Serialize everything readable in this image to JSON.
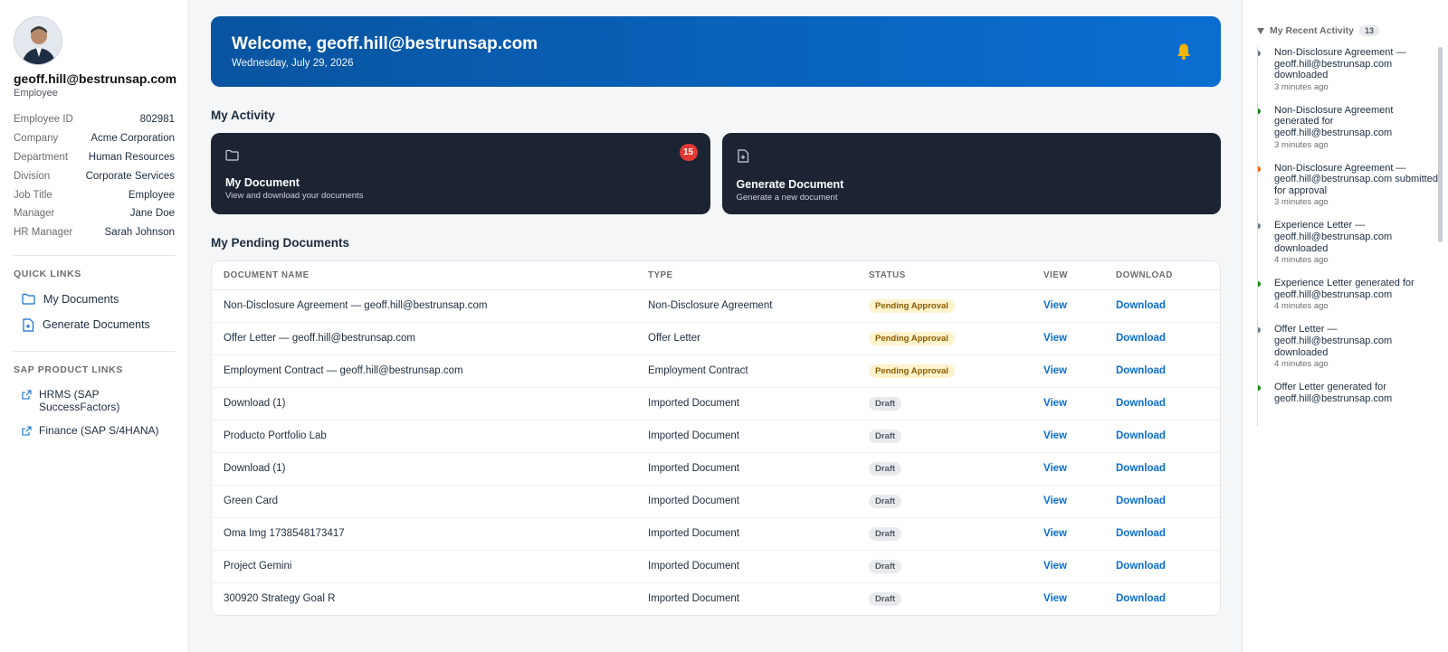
{
  "user": {
    "email": "geoff.hill@bestrunsap.com",
    "role": "Employee",
    "info": [
      {
        "label": "Employee ID",
        "value": "802981"
      },
      {
        "label": "Company",
        "value": "Acme Corporation"
      },
      {
        "label": "Department",
        "value": "Human Resources"
      },
      {
        "label": "Division",
        "value": "Corporate Services"
      },
      {
        "label": "Job Title",
        "value": "Employee"
      },
      {
        "label": "Manager",
        "value": "Jane Doe"
      },
      {
        "label": "HR Manager",
        "value": "Sarah Johnson"
      }
    ]
  },
  "quick_links": {
    "title": "QUICK LINKS",
    "items": [
      {
        "label": "My Documents",
        "icon": "folder-icon"
      },
      {
        "label": "Generate Documents",
        "icon": "file-plus-icon"
      }
    ]
  },
  "product_links": {
    "title": "SAP PRODUCT LINKS",
    "items": [
      {
        "label": "HRMS (SAP SuccessFactors)",
        "icon": "external-link-icon"
      },
      {
        "label": "Finance (SAP S/4HANA)",
        "icon": "external-link-icon"
      }
    ]
  },
  "banner": {
    "title": "Welcome, geoff.hill@bestrunsap.com",
    "date": "Wednesday, July 29, 2026",
    "icon": "bell-icon"
  },
  "activity": {
    "title": "My Activity",
    "cards": [
      {
        "title": "My Document",
        "subtitle": "View and download your documents",
        "badge": "15",
        "icon": "folder-icon"
      },
      {
        "title": "Generate Document",
        "subtitle": "Generate a new document",
        "icon": "file-plus-icon"
      }
    ]
  },
  "pending": {
    "title": "My Pending Documents",
    "columns": [
      "DOCUMENT NAME",
      "TYPE",
      "STATUS",
      "VIEW",
      "DOWNLOAD"
    ],
    "rows": [
      {
        "name": "Non-Disclosure Agreement — geoff.hill@bestrunsap.com",
        "type": "Non-Disclosure Agreement",
        "status": "Pending Approval",
        "view": "View",
        "download": "Download"
      },
      {
        "name": "Offer Letter — geoff.hill@bestrunsap.com",
        "type": "Offer Letter",
        "status": "Pending Approval",
        "view": "View",
        "download": "Download"
      },
      {
        "name": "Employment Contract — geoff.hill@bestrunsap.com",
        "type": "Employment Contract",
        "status": "Pending Approval",
        "view": "View",
        "download": "Download"
      },
      {
        "name": "Download (1)",
        "type": "Imported Document",
        "status": "Draft",
        "view": "View",
        "download": "Download"
      },
      {
        "name": "Producto Portfolio Lab",
        "type": "Imported Document",
        "status": "Draft",
        "view": "View",
        "download": "Download"
      },
      {
        "name": "Download (1)",
        "type": "Imported Document",
        "status": "Draft",
        "view": "View",
        "download": "Download"
      },
      {
        "name": "Green Card",
        "type": "Imported Document",
        "status": "Draft",
        "view": "View",
        "download": "Download"
      },
      {
        "name": "Oma Img 1738548173417",
        "type": "Imported Document",
        "status": "Draft",
        "view": "View",
        "download": "Download"
      },
      {
        "name": "Project Gemini",
        "type": "Imported Document",
        "status": "Draft",
        "view": "View",
        "download": "Download"
      },
      {
        "name": "300920 Strategy Goal R",
        "type": "Imported Document",
        "status": "Draft",
        "view": "View",
        "download": "Download"
      }
    ]
  },
  "recent": {
    "title": "My Recent Activity",
    "count": "13",
    "items": [
      {
        "text": "Non-Disclosure Agreement — geoff.hill@bestrunsap.com downloaded",
        "time": "3 minutes ago",
        "color": "#6a7b8c"
      },
      {
        "text": "Non-Disclosure Agreement generated for geoff.hill@bestrunsap.com",
        "time": "3 minutes ago",
        "color": "#188918"
      },
      {
        "text": "Non-Disclosure Agreement — geoff.hill@bestrunsap.com submitted for approval",
        "time": "3 minutes ago",
        "color": "#e76500"
      },
      {
        "text": "Experience Letter — geoff.hill@bestrunsap.com downloaded",
        "time": "4 minutes ago",
        "color": "#6a7b8c"
      },
      {
        "text": "Experience Letter generated for geoff.hill@bestrunsap.com",
        "time": "4 minutes ago",
        "color": "#188918"
      },
      {
        "text": "Offer Letter — geoff.hill@bestrunsap.com downloaded",
        "time": "4 minutes ago",
        "color": "#6a7b8c"
      },
      {
        "text": "Offer Letter generated for geoff.hill@bestrunsap.com",
        "time": "",
        "color": "#188918"
      }
    ]
  }
}
